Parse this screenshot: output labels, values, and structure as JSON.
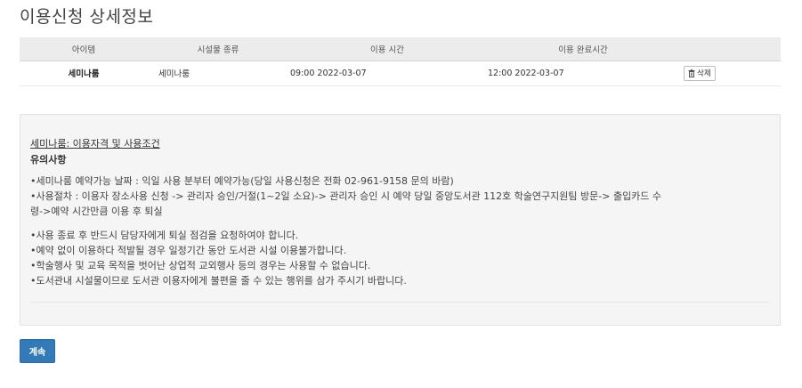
{
  "page": {
    "title": "이용신청 상세정보"
  },
  "table": {
    "headers": [
      "아이템",
      "시설물 종류",
      "이용 시간",
      "이용 완료시간",
      ""
    ],
    "rows": [
      {
        "item": "세미나룸",
        "type": "세미나룸",
        "start": "09:00 2022-03-07",
        "end": "12:00 2022-03-07",
        "delete_label": "삭제",
        "delete_icon": "trash-icon"
      }
    ]
  },
  "info": {
    "conditions_link": "세미나룸: 이용자격 및 사용조건",
    "notice_heading": "유의사항",
    "rules_group1": [
      "•세미나룸 예약가능 날짜 : 익일 사용 분부터 예약가능(당일 사용신청은 전화 02-961-9158 문의 바람)",
      "•사용절차 : 이용자 장소사용 신청 -> 관리자 승인/거절(1~2일 소요)-> 관리자 승인 시 예약 당일 중앙도서관 112호 학술연구지원팀 방문-> 출입카드 수",
      "령->예약 시간만큼 이용 후 퇴실"
    ],
    "rules_group2": [
      "•사용 종료 후 반드시 담당자에게 퇴실 점검을 요청하여야 합니다.",
      "•예약 없이 이용하다 적발될 경우 일정기간 동안 도서관 시설 이용불가합니다.",
      "•학술행사 및 교육 목적을 벗어난 상업적 교외행사 등의 경우는 사용할 수 없습니다.",
      "•도서관내 시설물이므로 도서관 이용자에게 불편을 줄 수 있는 행위를 삼가 주시기 바랍니다."
    ]
  },
  "actions": {
    "continue_label": "계속"
  },
  "colors": {
    "primary_button": "#337ab7",
    "table_header_bg": "#ececec",
    "panel_bg": "#f5f5f5"
  }
}
